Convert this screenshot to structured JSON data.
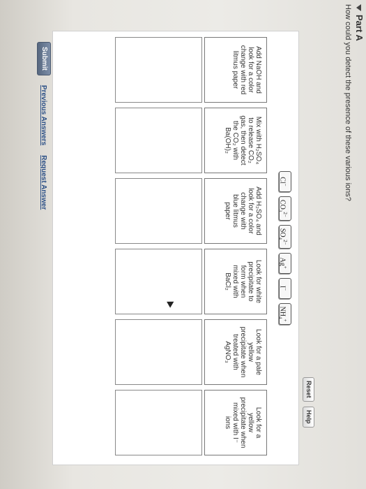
{
  "part": {
    "label": "Part A"
  },
  "question": "How could you detect the presence of these various ions?",
  "toolbar": {
    "reset_label": "Reset",
    "help_label": "Help"
  },
  "ions": [
    {
      "base": "Cl",
      "charge": "−"
    },
    {
      "base": "CO₃",
      "charge": "2−"
    },
    {
      "base": "SO₄",
      "charge": "2−"
    },
    {
      "base": "Ag",
      "charge": "+"
    },
    {
      "base": "I",
      "charge": "−"
    },
    {
      "base": "NH₄",
      "charge": "+"
    }
  ],
  "options": [
    "Add NaOH and\nlook for a color\nchange with red\nlitmus paper",
    "Mix with H₂SO₄\nto release CO₂\ngas, then detect\nthe CO₂ with\nBa(OH)₂",
    "Add H₂SO₄ and\nlook for a color\nchange with\nblue litmus\npaper",
    "Look for white\nprecipitate to\nform when\nmixed with\nBaCl₂",
    "Look for a pale\nyellow\nprecipitate when\ntreated with\nAgNO₃",
    "Look for a\nyellow\nprecipitate when\nmixed with I⁻\nions"
  ],
  "footer": {
    "submit_label": "Submit",
    "previous_label": "Previous Answers",
    "request_label": "Request Answer"
  }
}
